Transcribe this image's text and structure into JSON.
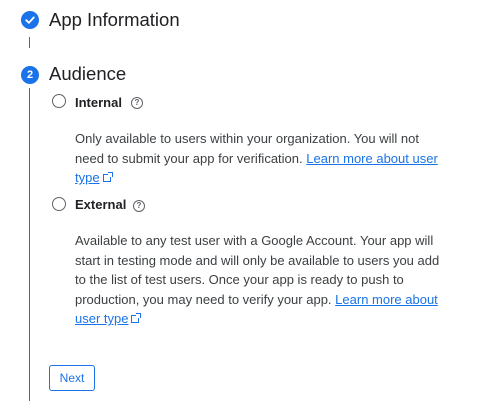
{
  "steps": [
    {
      "number": "",
      "title": "App Information",
      "status": "complete"
    },
    {
      "number": "2",
      "title": "Audience",
      "status": "active"
    }
  ],
  "audience": {
    "options": [
      {
        "label": "Internal",
        "description": "Only available to users within your organization. You will not need to submit your app for verification.",
        "link_text": "Learn more about user type"
      },
      {
        "label": "External",
        "description": "Available to any test user with a Google Account. Your app will start in testing mode and will only be available to users you add to the list of test users. Once your app is ready to push to production, you may need to verify your app.",
        "link_text": "Learn more about user type"
      }
    ]
  },
  "buttons": {
    "next": "Next"
  },
  "icons": {
    "step_complete": "check-icon",
    "help": "help-circle-icon",
    "external_link": "open-in-new-icon"
  },
  "colors": {
    "accent": "#1a73e8",
    "text": "#202124",
    "muted": "#5f6368"
  }
}
